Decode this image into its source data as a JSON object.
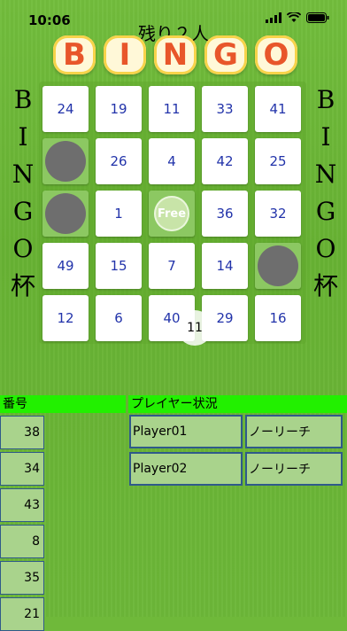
{
  "status": {
    "time": "10:06"
  },
  "header": {
    "remaining": "残り２人",
    "title_letters": [
      "B",
      "I",
      "N",
      "G",
      "O"
    ]
  },
  "side_left": [
    "B",
    "I",
    "N",
    "G",
    "O",
    "杯"
  ],
  "side_right": [
    "B",
    "I",
    "N",
    "G",
    "O",
    "杯"
  ],
  "board": [
    [
      "24",
      "19",
      "11",
      "33",
      "41"
    ],
    [
      "HIT",
      "26",
      "4",
      "42",
      "25"
    ],
    [
      "HIT",
      "1",
      "FREE",
      "36",
      "32"
    ],
    [
      "49",
      "15",
      "7",
      "14",
      "HIT"
    ],
    [
      "12",
      "6",
      "40",
      "29",
      "16"
    ]
  ],
  "free_label": "Free",
  "current_call": "11",
  "panels": {
    "numbers_header": "番号",
    "players_header": "プレイヤー状況",
    "called_numbers": [
      "38",
      "34",
      "43",
      "8",
      "35",
      "21"
    ],
    "players": [
      {
        "name": "Player01",
        "state": "ノーリーチ"
      },
      {
        "name": "Player02",
        "state": "ノーリーチ"
      }
    ]
  }
}
